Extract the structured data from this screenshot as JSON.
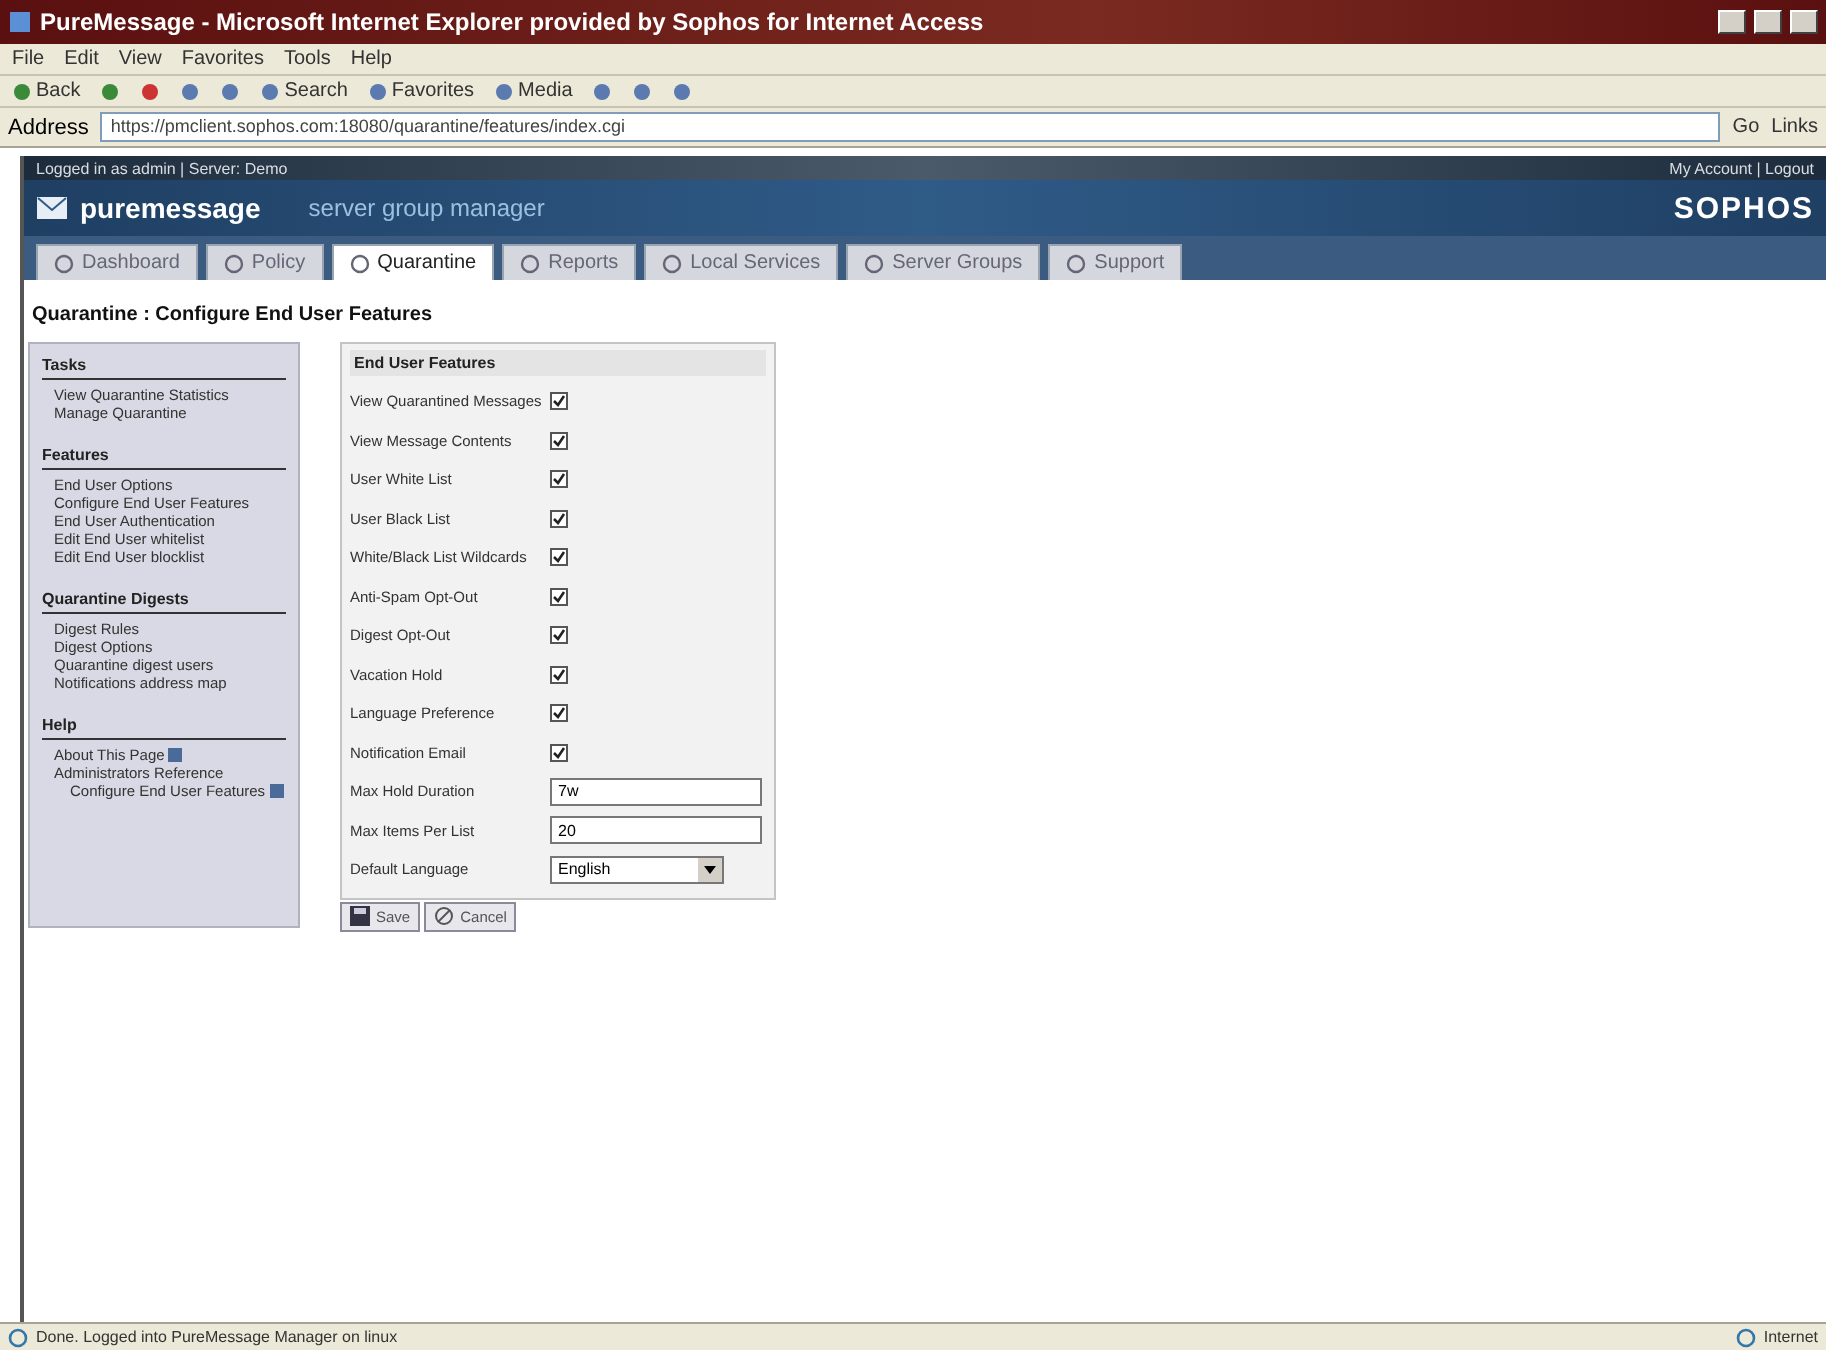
{
  "window": {
    "title": "PureMessage - Microsoft Internet Explorer provided by Sophos for Internet Access"
  },
  "menu": [
    "File",
    "Edit",
    "View",
    "Favorites",
    "Tools",
    "Help"
  ],
  "toolbar": [
    {
      "kind": "back",
      "label": "Back"
    },
    {
      "kind": "forward"
    },
    {
      "kind": "stop"
    },
    {
      "kind": "refresh"
    },
    {
      "kind": "home"
    },
    {
      "kind": "search",
      "label": "Search"
    },
    {
      "kind": "favorites",
      "label": "Favorites"
    },
    {
      "kind": "media",
      "label": "Media"
    },
    {
      "kind": "history"
    },
    {
      "kind": "mail"
    },
    {
      "kind": "print"
    }
  ],
  "address": {
    "label": "Address",
    "value": "https://pmclient.sophos.com:18080/quarantine/features/index.cgi",
    "go": "Go",
    "links": "Links"
  },
  "session": {
    "logged_in": "Logged in as admin | Server: Demo",
    "account": "My Account | Logout"
  },
  "banner": {
    "product": "puremessage",
    "subtitle": "server group manager",
    "brand": "SOPHOS"
  },
  "tabs": [
    {
      "label": "Dashboard",
      "selected": false
    },
    {
      "label": "Policy",
      "selected": false
    },
    {
      "label": "Quarantine",
      "selected": true
    },
    {
      "label": "Reports",
      "selected": false
    },
    {
      "label": "Local Services",
      "selected": false
    },
    {
      "label": "Server Groups",
      "selected": false
    },
    {
      "label": "Support",
      "selected": false
    }
  ],
  "breadcrumb": "Quarantine : Configure End User Features",
  "sidebar": [
    {
      "heading": "Tasks",
      "items": [
        {
          "label": "View Quarantine Statistics"
        },
        {
          "label": "Manage Quarantine"
        }
      ]
    },
    {
      "heading": "Features",
      "items": [
        {
          "label": "End User Options"
        },
        {
          "label": "Configure End User Features"
        },
        {
          "label": "End User Authentication"
        },
        {
          "label": "Edit End User whitelist"
        },
        {
          "label": "Edit End User blocklist"
        }
      ]
    },
    {
      "heading": "Quarantine Digests",
      "items": [
        {
          "label": "Digest Rules"
        },
        {
          "label": "Digest Options"
        },
        {
          "label": "Quarantine digest users"
        },
        {
          "label": "Notifications address map"
        }
      ]
    },
    {
      "heading": "Help",
      "items": [
        {
          "label": "About This Page",
          "help": true
        },
        {
          "label": "Administrators Reference",
          "help": false
        },
        {
          "label": "Configure End User Features",
          "help": true,
          "indented": true
        }
      ]
    }
  ],
  "form": {
    "title": "End User Features",
    "rows": [
      {
        "kind": "checkbox",
        "label": "View Quarantined Messages",
        "checked": true
      },
      {
        "kind": "checkbox",
        "label": "View Message Contents",
        "checked": true
      },
      {
        "kind": "checkbox",
        "label": "User White List",
        "checked": true
      },
      {
        "kind": "checkbox",
        "label": "User Black List",
        "checked": true
      },
      {
        "kind": "checkbox",
        "label": "White/Black List Wildcards",
        "checked": true
      },
      {
        "kind": "checkbox",
        "label": "Anti-Spam Opt-Out",
        "checked": true
      },
      {
        "kind": "checkbox",
        "label": "Digest Opt-Out",
        "checked": true
      },
      {
        "kind": "checkbox",
        "label": "Vacation Hold",
        "checked": true
      },
      {
        "kind": "checkbox",
        "label": "Language Preference",
        "checked": true
      },
      {
        "kind": "checkbox",
        "label": "Notification Email",
        "checked": true
      },
      {
        "kind": "text",
        "label": "Max Hold Duration",
        "value": "7w"
      },
      {
        "kind": "text",
        "label": "Max Items Per List",
        "value": "20"
      },
      {
        "kind": "select",
        "label": "Default Language",
        "value": "English"
      }
    ],
    "buttons": [
      "Save",
      "Cancel"
    ]
  },
  "status_bar": {
    "text": "Done. Logged into PureMessage Manager on linux",
    "zone": "Internet"
  }
}
